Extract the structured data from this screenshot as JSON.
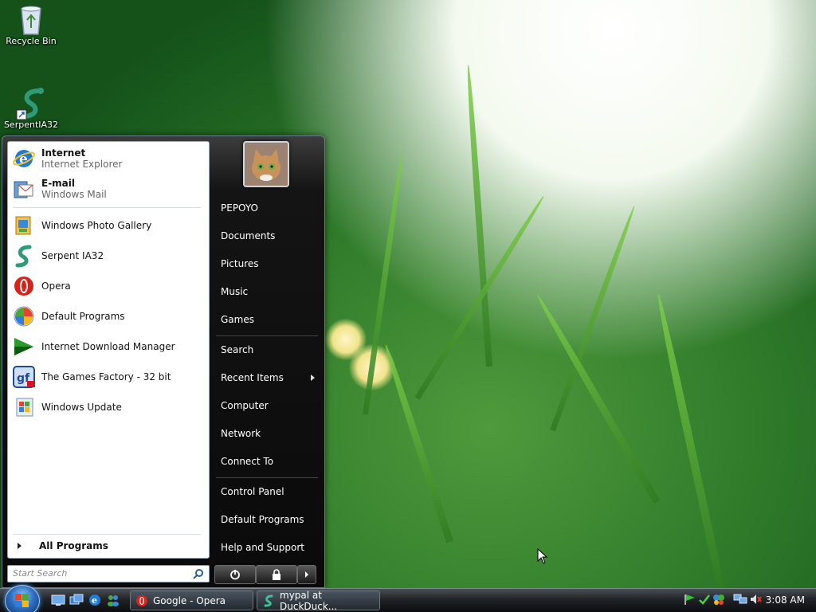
{
  "desktop": {
    "icons": [
      {
        "label": "Recycle Bin",
        "icon": "recycle-bin-icon"
      },
      {
        "label": "SerpentIA32",
        "icon": "serpent-icon"
      }
    ]
  },
  "start_menu": {
    "pinned": [
      {
        "title": "Internet",
        "subtitle": "Internet Explorer",
        "icon": "internet-explorer-icon"
      },
      {
        "title": "E-mail",
        "subtitle": "Windows Mail",
        "icon": "windows-mail-icon"
      }
    ],
    "recent": [
      {
        "label": "Windows Photo Gallery",
        "icon": "photo-gallery-icon"
      },
      {
        "label": "Serpent IA32",
        "icon": "serpent-icon"
      },
      {
        "label": "Opera",
        "icon": "opera-icon"
      },
      {
        "label": "Default Programs",
        "icon": "default-programs-icon"
      },
      {
        "label": "Internet Download Manager",
        "icon": "idm-icon"
      },
      {
        "label": "The Games Factory - 32 bit",
        "icon": "games-factory-icon"
      },
      {
        "label": "Windows Update",
        "icon": "windows-update-icon"
      }
    ],
    "all_programs_label": "All Programs",
    "search_placeholder": "Start Search",
    "right_items": {
      "user": "PEPOYO",
      "documents": "Documents",
      "pictures": "Pictures",
      "music": "Music",
      "games": "Games",
      "search": "Search",
      "recent_items": "Recent Items",
      "computer": "Computer",
      "network": "Network",
      "connect_to": "Connect To",
      "control_panel": "Control Panel",
      "default_programs": "Default Programs",
      "help_support": "Help and Support"
    }
  },
  "taskbar": {
    "tasks": [
      {
        "label": "Google - Opera",
        "icon": "opera-icon"
      },
      {
        "label": "mypal at DuckDuck...",
        "icon": "serpent-icon"
      }
    ],
    "clock": "3:08 AM"
  },
  "colors": {
    "start_menu_bg": "#0a0a0a",
    "left_pane_bg": "#ffffff",
    "taskbar_bg": "#1f2226",
    "desktop_green": "#2f7a2a"
  }
}
